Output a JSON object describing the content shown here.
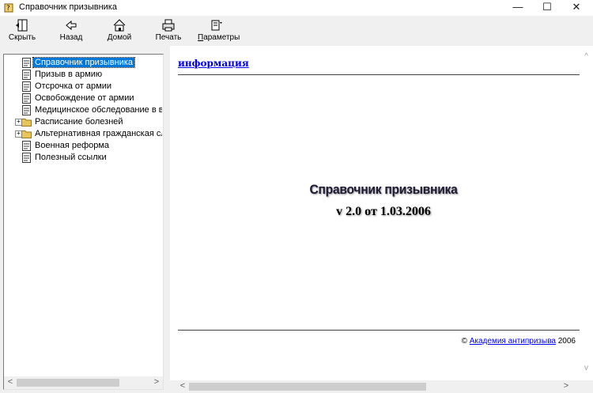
{
  "window": {
    "title": "Справочник призывника"
  },
  "window_controls": {
    "minimize": "—",
    "maximize": "☐",
    "close": "✕"
  },
  "toolbar": {
    "hide": "Скрыть",
    "back": "Назад",
    "home": "Домой",
    "print": "Печать",
    "options_first": "П",
    "options_rest": "араметры"
  },
  "tree": {
    "items": [
      {
        "label": "Справочник призывника",
        "selected": true,
        "folder": false
      },
      {
        "label": "Призыв в армию",
        "folder": false
      },
      {
        "label": "Отсрочка от армии",
        "folder": false
      },
      {
        "label": "Освобождение от армии",
        "folder": false
      },
      {
        "label": "Медицинское обследование в во",
        "folder": false
      },
      {
        "label": "Расписание болезней",
        "folder": true,
        "expander": "+"
      },
      {
        "label": "Альтернативная гражданская слу",
        "folder": true,
        "expander": "+"
      },
      {
        "label": "Военная реформа",
        "folder": false
      },
      {
        "label": "Полезный ссылки",
        "folder": false
      }
    ]
  },
  "content": {
    "info_link": "информация",
    "main_title": "Справочник призывника",
    "version": "v 2.0 от 1.03.2006",
    "copyright_symbol": "©",
    "copyright_link": "Академия антипризыва",
    "copyright_year": "2006"
  },
  "scroll": {
    "left": "<",
    "right": ">",
    "up": "^",
    "down": "v"
  },
  "colors": {
    "selection": "#0078d7",
    "link": "#0000ee",
    "folder": "#e8c55a"
  }
}
